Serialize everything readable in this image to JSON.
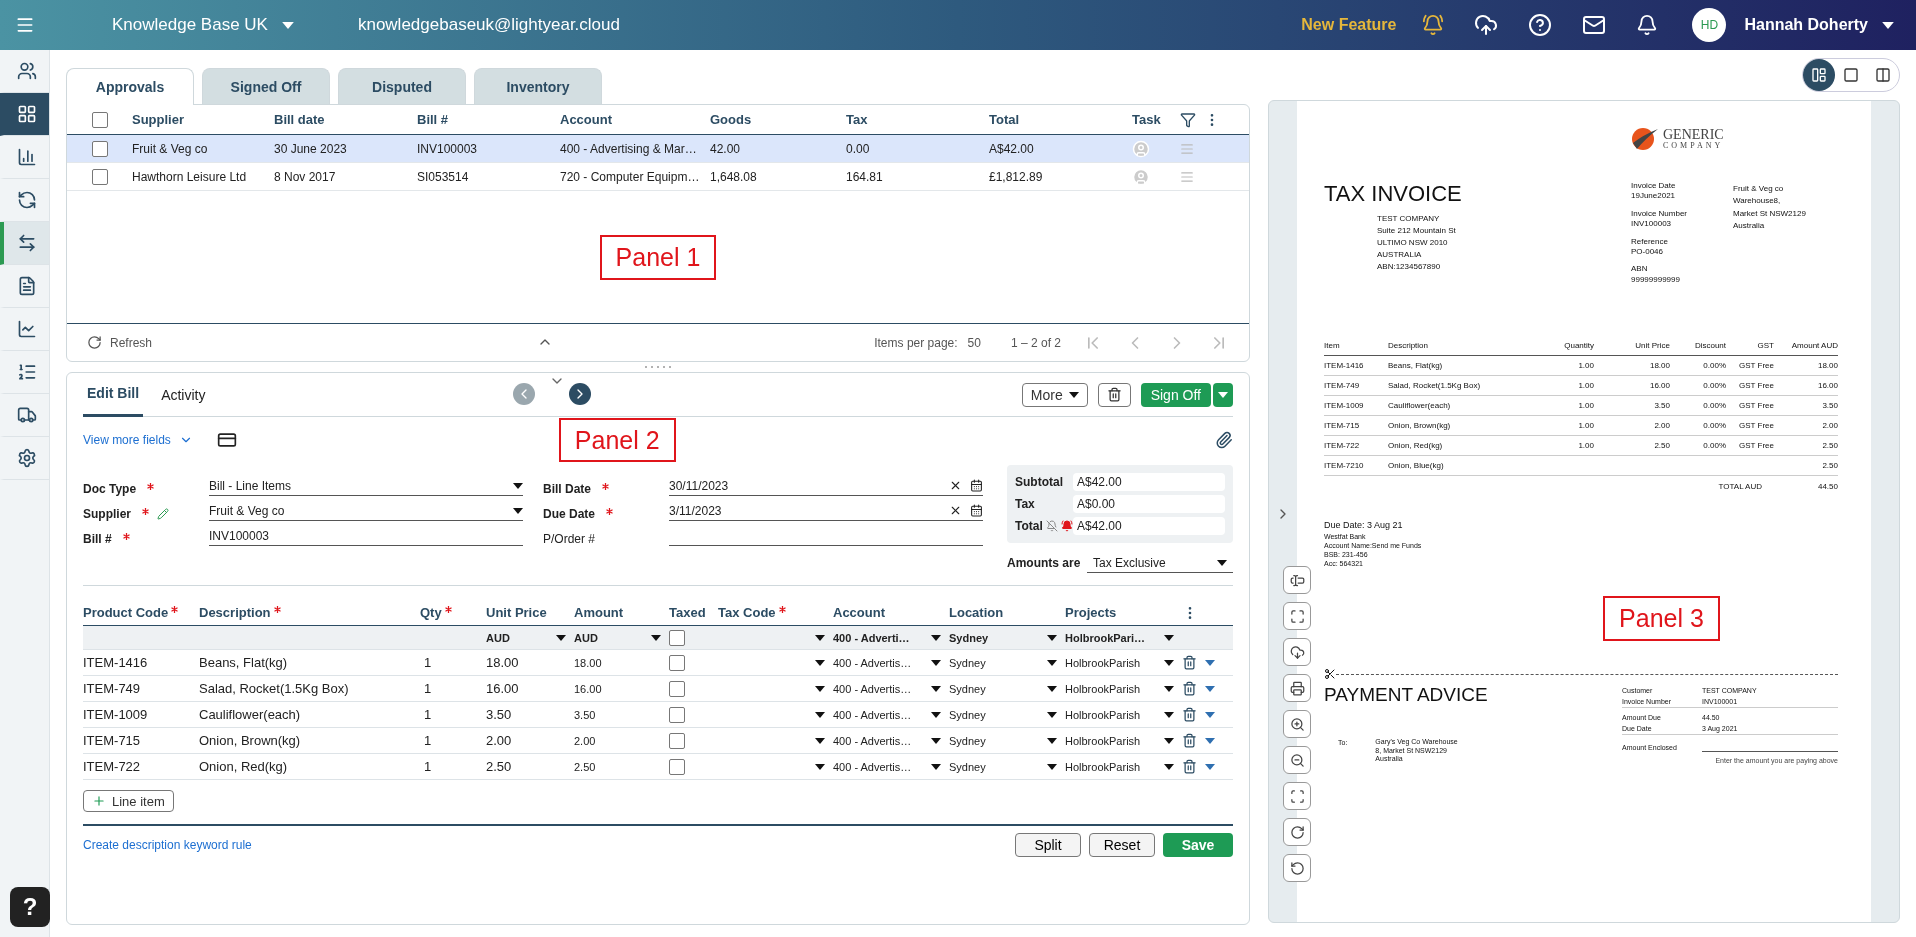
{
  "top_bar": {
    "org": "Knowledge Base UK",
    "email": "knowledgebaseuk@lightyear.cloud",
    "new_feature": "New Feature",
    "user": {
      "initials": "HD",
      "name": "Hannah Doherty"
    }
  },
  "sidebar": {
    "items": [
      {
        "selected": false,
        "hovered": false
      },
      {
        "selected": false,
        "hovered": true
      },
      {
        "selected": false,
        "hovered": false
      },
      {
        "selected": false,
        "hovered": false
      },
      {
        "selected": true,
        "hovered": false
      },
      {
        "selected": false,
        "hovered": false
      },
      {
        "selected": false,
        "hovered": false
      },
      {
        "selected": false,
        "hovered": false
      },
      {
        "selected": false,
        "hovered": false
      },
      {
        "selected": false,
        "hovered": false
      }
    ],
    "help": "?"
  },
  "view_modes": [
    {
      "selected": true
    },
    {
      "selected": false
    },
    {
      "selected": false
    }
  ],
  "tabs": [
    {
      "label": "Approvals",
      "selected": true
    },
    {
      "label": "Signed Off",
      "selected": false
    },
    {
      "label": "Disputed",
      "selected": false
    },
    {
      "label": "Inventory",
      "selected": false
    }
  ],
  "bills_table": {
    "select_all": false,
    "columns": [
      "Supplier",
      "Bill date",
      "Bill #",
      "Account",
      "Goods",
      "Tax",
      "Total",
      "Task"
    ],
    "rows": [
      {
        "checked": false,
        "selected": true,
        "cells": [
          "Fruit & Veg co",
          "30 June 2023",
          "INV100003",
          "400 - Advertising & Mar…",
          "42.00",
          "0.00",
          "A$42.00"
        ]
      },
      {
        "checked": false,
        "selected": false,
        "cells": [
          "Hawthorn Leisure Ltd",
          "8 Nov 2017",
          "SI053514",
          "720 - Computer Equipm…",
          "1,648.08",
          "164.81",
          "£1,812.89"
        ]
      }
    ],
    "annotation": "Panel 1",
    "footer": {
      "refresh": "Refresh",
      "items_per_page": "Items per page:",
      "page_size": "50",
      "range": "1 – 2 of 2"
    }
  },
  "edit_panel": {
    "tabs": [
      {
        "label": "Edit Bill",
        "selected": true
      },
      {
        "label": "Activity",
        "selected": false
      }
    ],
    "more": "More",
    "sign_off": "Sign Off",
    "view_more": "View more fields",
    "annotation": "Panel 2",
    "fields": [
      {
        "label": "Doc Type",
        "required": true,
        "kind": "select",
        "value": "Bill - Line Items",
        "editable": false
      },
      {
        "label": "Supplier",
        "required": true,
        "kind": "select",
        "value": "Fruit & Veg co",
        "editable": true
      },
      {
        "label": "Bill #",
        "required": true,
        "kind": "text",
        "value": "INV100003",
        "editable": false
      },
      {
        "label": "Bill Date",
        "required": true,
        "kind": "date",
        "value": "30/11/2023",
        "editable": false
      },
      {
        "label": "Due Date",
        "required": true,
        "kind": "date",
        "value": "3/11/2023",
        "editable": false
      },
      {
        "label": "P/Order #",
        "required": false,
        "kind": "text",
        "editable": false
      }
    ],
    "totals": [
      {
        "label": "Subtotal",
        "value": "A$42.00",
        "kind": "plain"
      },
      {
        "label": "Tax",
        "value": "A$0.00",
        "kind": "plain"
      },
      {
        "label": "Total",
        "value": "A$42.00",
        "kind": "alerts"
      }
    ],
    "amounts_are": {
      "label": "Amounts are",
      "value": "Tax Exclusive"
    },
    "line_columns": [
      {
        "label": "Product Code",
        "required": true
      },
      {
        "label": "Description",
        "required": true
      },
      {
        "label": "Qty",
        "required": true
      },
      {
        "label": "Unit Price",
        "required": false
      },
      {
        "label": "Amount",
        "required": false
      },
      {
        "label": "Taxed",
        "required": false
      },
      {
        "label": "Tax Code",
        "required": true
      },
      {
        "label": "Account",
        "required": false
      },
      {
        "label": "Location",
        "required": false
      },
      {
        "label": "Projects",
        "required": false
      }
    ],
    "line_filters": {
      "unit_price": "AUD",
      "amount": "AUD",
      "taxed": false,
      "account": "400 - Adverti…",
      "location": "Sydney",
      "project": "HolbrookPari…"
    },
    "lines": [
      {
        "code": "ITEM-1416",
        "description": "Beans, Flat(kg)",
        "qty": "1",
        "unit_price": "18.00",
        "amount": "18.00",
        "taxed": false,
        "account": "400 - Advertis…",
        "location": "Sydney",
        "project": "HolbrookParish"
      },
      {
        "code": "ITEM-749",
        "description": "Salad, Rocket(1.5Kg Box)",
        "qty": "1",
        "unit_price": "16.00",
        "amount": "16.00",
        "taxed": false,
        "account": "400 - Advertis…",
        "location": "Sydney",
        "project": "HolbrookParish"
      },
      {
        "code": "ITEM-1009",
        "description": "Cauliflower(each)",
        "qty": "1",
        "unit_price": "3.50",
        "amount": "3.50",
        "taxed": false,
        "account": "400 - Advertis…",
        "location": "Sydney",
        "project": "HolbrookParish"
      },
      {
        "code": "ITEM-715",
        "description": "Onion, Brown(kg)",
        "qty": "1",
        "unit_price": "2.00",
        "amount": "2.00",
        "taxed": false,
        "account": "400 - Advertis…",
        "location": "Sydney",
        "project": "HolbrookParish"
      },
      {
        "code": "ITEM-722",
        "description": "Onion, Red(kg)",
        "qty": "1",
        "unit_price": "2.50",
        "amount": "2.50",
        "taxed": false,
        "account": "400 - Advertis…",
        "location": "Sydney",
        "project": "HolbrookParish"
      }
    ],
    "add_line": "Line item",
    "keyword_rule": "Create description keyword rule",
    "buttons": [
      "Split",
      "Reset",
      "Save"
    ]
  },
  "viewer": {
    "annotation": "Panel 3",
    "document": {
      "logo": {
        "line_1": "GENERIC",
        "line_2": "COMPANY"
      },
      "title": "TAX INVOICE",
      "from": [
        "TEST COMPANY",
        "Suite 212 Mountain St",
        "ULTIMO NSW 2010",
        "AUSTRALIA",
        "ABN:1234567890"
      ],
      "meta": [
        {
          "label": "Invoice Date",
          "value": "19June2021"
        },
        {
          "label": "Invoice Number",
          "value": "INV100003"
        },
        {
          "label": "Reference",
          "value": "PO-0046"
        },
        {
          "label": "ABN",
          "value": "99999999999"
        }
      ],
      "to": [
        "Fruit & Veg co",
        "Warehouse8,",
        "Market St NSW2129",
        "Australia"
      ],
      "columns": [
        "Item",
        "Description",
        "Quantity",
        "Unit Price",
        "Discount",
        "GST",
        "Amount AUD"
      ],
      "rows": [
        [
          "ITEM-1416",
          "Beans, Flat(kg)",
          "1.00",
          "18.00",
          "0.00%",
          "GST Free",
          "18.00"
        ],
        [
          "ITEM-749",
          "Salad, Rocket(1.5Kg Box)",
          "1.00",
          "16.00",
          "0.00%",
          "GST Free",
          "16.00"
        ],
        [
          "ITEM-1009",
          "Cauliflower(each)",
          "1.00",
          "3.50",
          "0.00%",
          "GST Free",
          "3.50"
        ],
        [
          "ITEM-715",
          "Onion, Brown(kg)",
          "1.00",
          "2.00",
          "0.00%",
          "GST Free",
          "2.00"
        ],
        [
          "ITEM-722",
          "Onion, Red(kg)",
          "1.00",
          "2.50",
          "0.00%",
          "GST Free",
          "2.50"
        ],
        [
          "ITEM-7210",
          "Onion, Blue(kg)",
          "",
          "",
          "",
          "",
          "2.50"
        ]
      ],
      "total_label": "TOTAL AUD",
      "total": "44.50",
      "due": "Due Date: 3 Aug 21",
      "bank": [
        "Westfat Bank",
        "Account Name:Send me Funds",
        "BSB: 231-456",
        "Acc: 564321"
      ],
      "advice_title": "PAYMENT ADVICE",
      "advice": [
        {
          "label": "Customer",
          "value": "TEST COMPANY"
        },
        {
          "label": "Invoice Number",
          "value": "INV100001"
        },
        {
          "label": "Amount Due",
          "value": "44.50"
        },
        {
          "label": "Due Date",
          "value": "3 Aug 2021"
        }
      ],
      "enclosed": "Amount Enclosed",
      "enclosed_hint": "Enter the amount you are paying above",
      "to_label": "To:",
      "advice_to": [
        "Gary's Veg Co Warehouse",
        "8, Market St NSW2129",
        "Australia"
      ]
    }
  }
}
